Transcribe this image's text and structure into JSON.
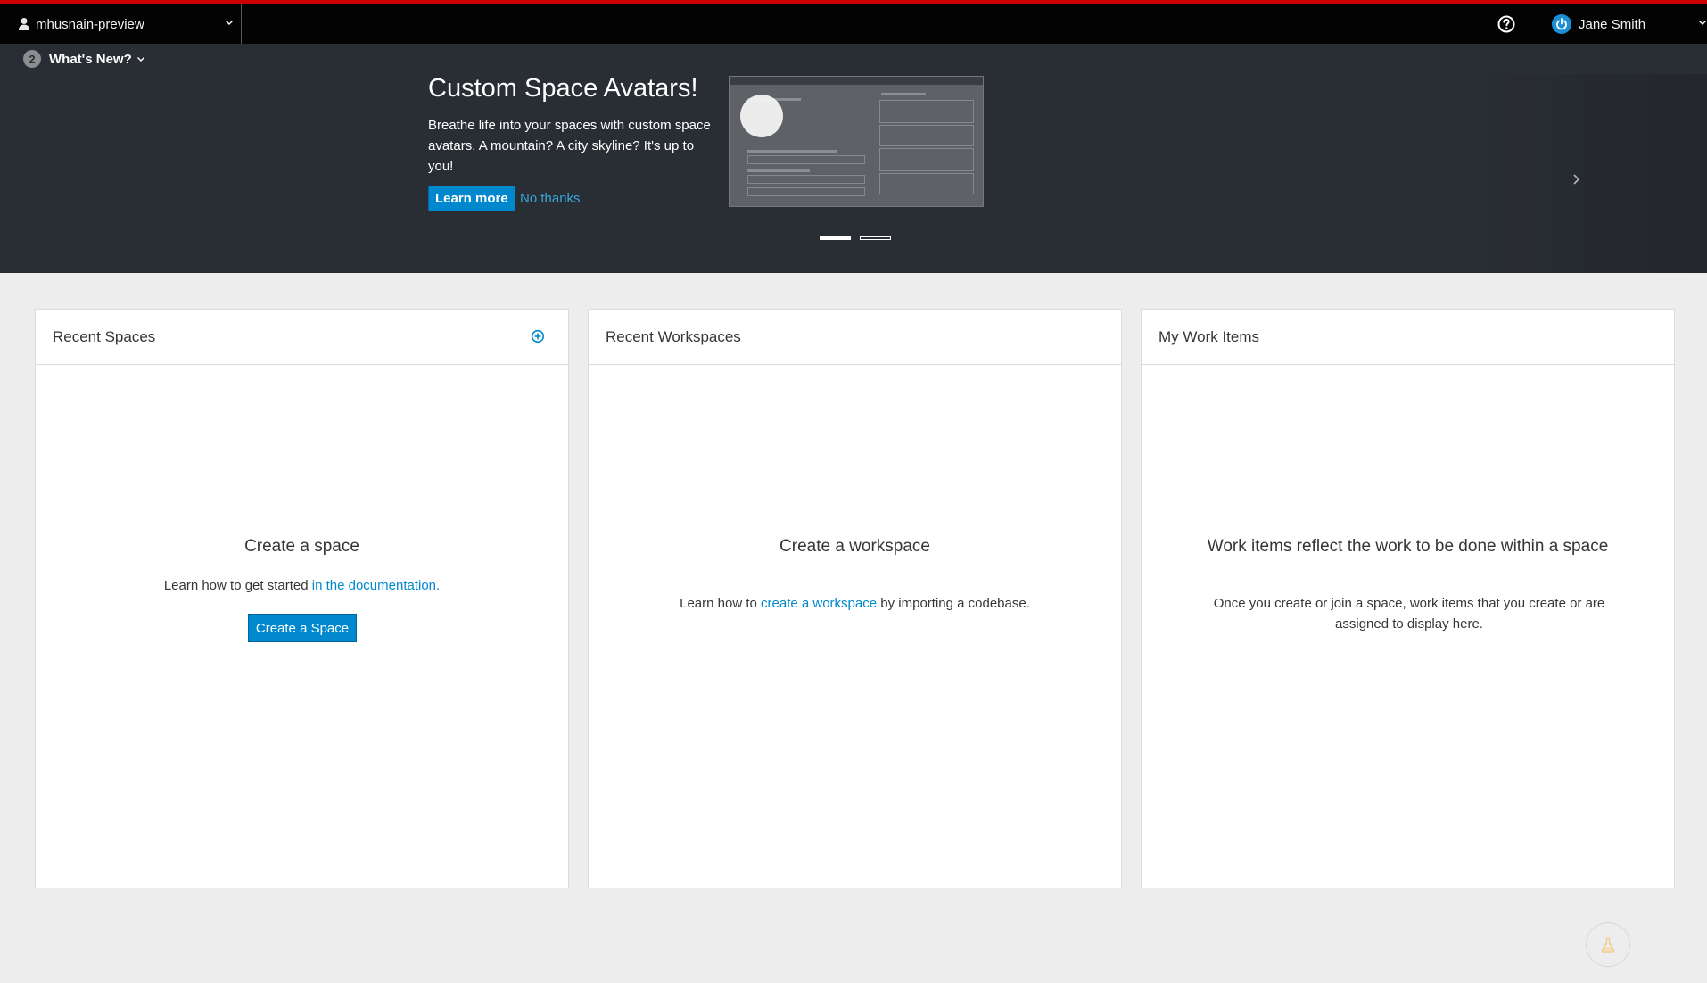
{
  "topbar": {
    "context_label": "mhusnain-preview",
    "user_name": "Jane Smith",
    "accent_color": "#cc0000"
  },
  "banner": {
    "whats_new_count": "2",
    "whats_new_label": "What's New?",
    "title": "Custom Space Avatars!",
    "description": "Breathe life into your spaces with custom space avatars. A mountain? A city skyline? It's up to you!",
    "learn_more": "Learn more",
    "no_thanks": "No thanks",
    "slide_count": 2,
    "active_slide": 1
  },
  "cards": {
    "spaces": {
      "title": "Recent Spaces",
      "empty_title": "Create a space",
      "text_prefix": "Learn how to get started ",
      "link": "in the documentation.",
      "button": "Create a Space"
    },
    "workspaces": {
      "title": "Recent Workspaces",
      "empty_title": "Create a workspace",
      "text_prefix": "Learn how to ",
      "link": "create a workspace",
      "text_suffix": " by importing a codebase."
    },
    "work_items": {
      "title": "My Work Items",
      "empty_title": "Work items reflect the work to be done within a space",
      "text": "Once you create or join a space, work items that you create or are assigned to display here."
    }
  },
  "colors": {
    "primary": "#0088ce",
    "banner_bg": "#292e34",
    "page_bg": "#ededed"
  }
}
